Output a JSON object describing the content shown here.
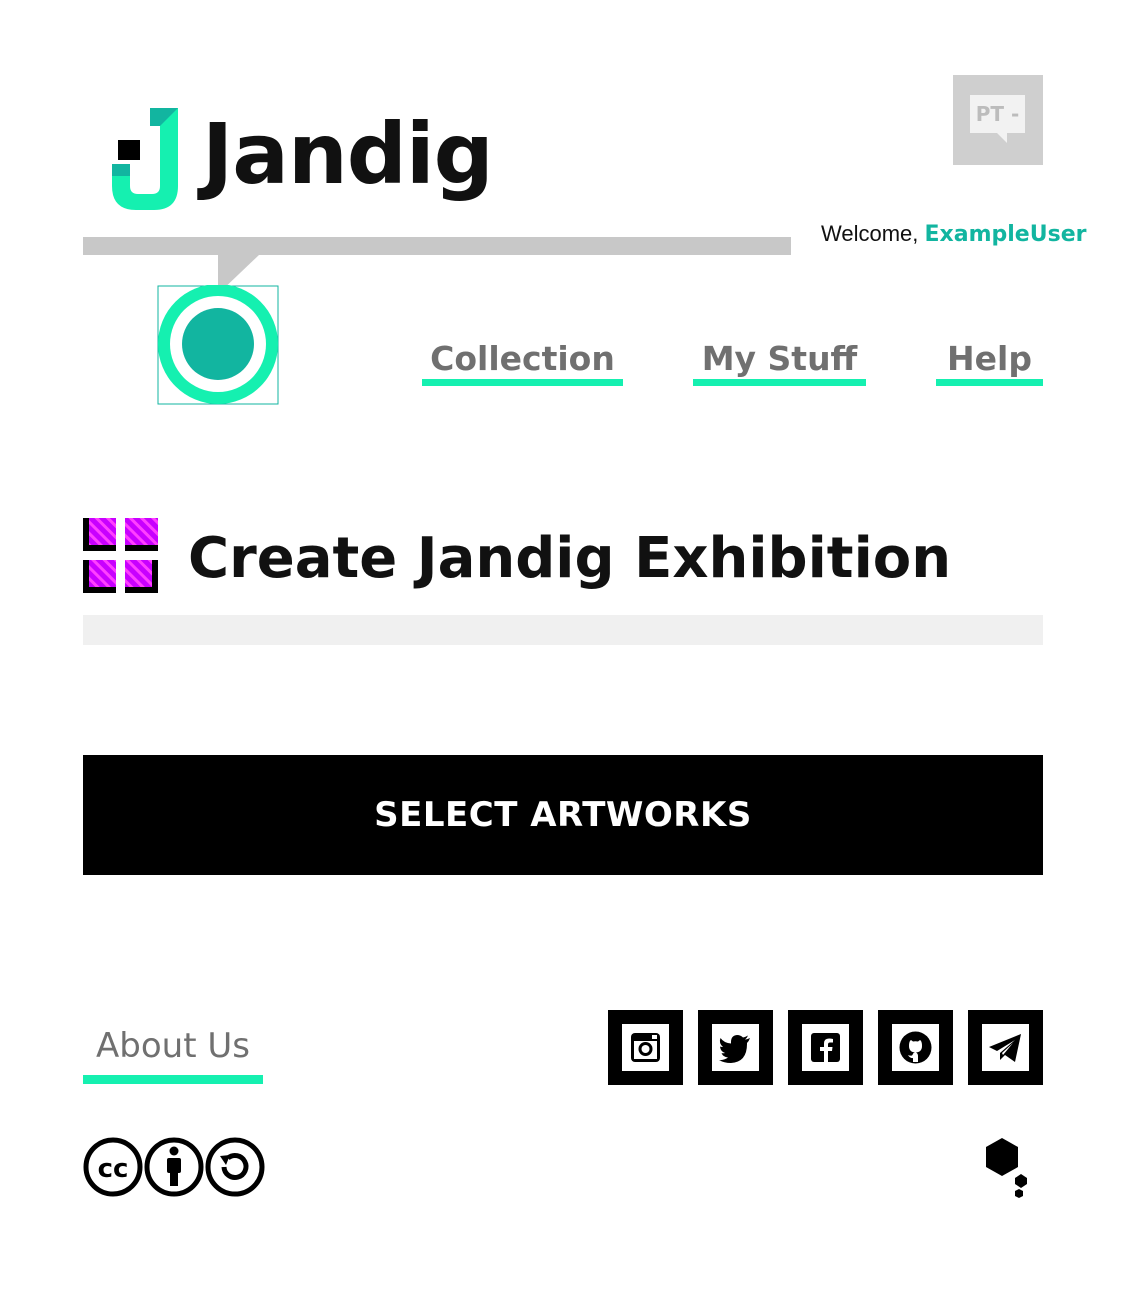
{
  "brand": {
    "name": "Jandig",
    "accent_color": "#15f0b0",
    "accent_dark": "#12b5a0",
    "icon": "jandig-logo-icon"
  },
  "language": {
    "label": "PT -",
    "icon": "speech-bubble-icon"
  },
  "user": {
    "welcome_prefix": "Welcome,",
    "username": "ExampleUser",
    "avatar_icon": "profile-icon"
  },
  "nav": {
    "items": [
      {
        "label": "Collection"
      },
      {
        "label": "My Stuff"
      },
      {
        "label": "Help"
      }
    ]
  },
  "main": {
    "title": "Create Jandig Exhibition",
    "title_icon": "exhibition-grid-icon",
    "cta_label": "SELECT ARTWORKS"
  },
  "footer": {
    "about_label": "About Us",
    "social_icons": [
      "instagram-icon",
      "twitter-icon",
      "facebook-icon",
      "github-icon",
      "telegram-icon"
    ],
    "license_icon": "creative-commons-by-sa-icon",
    "lab_logo_icon": "hexagon-lab-logo-icon"
  }
}
